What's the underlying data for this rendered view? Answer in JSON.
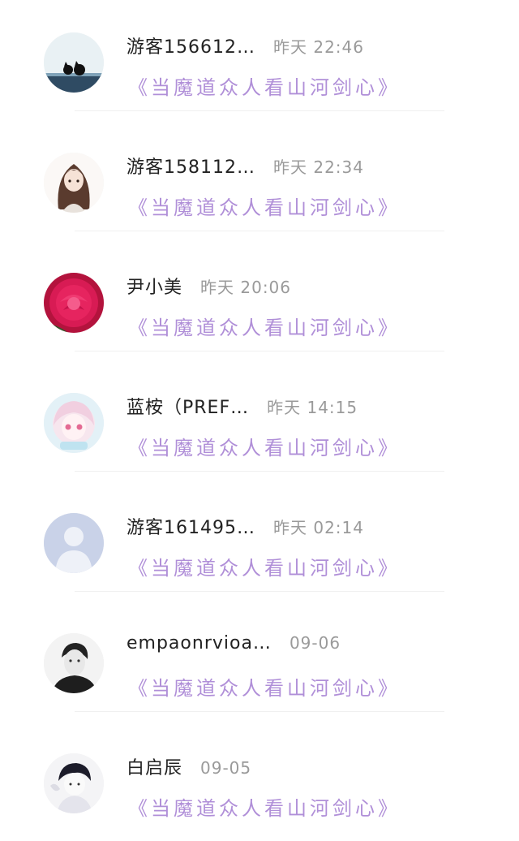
{
  "messages": [
    {
      "name": "游客156612…",
      "time": "昨天 22:46",
      "title": "《当魔道众人看山河剑心》",
      "avatar": "cats-silhouette-avatar"
    },
    {
      "name": "游客158112…",
      "time": "昨天 22:34",
      "title": "《当魔道众人看山河剑心》",
      "avatar": "girl-illustration-avatar"
    },
    {
      "name": "尹小美",
      "time": "昨天 20:06",
      "title": "《当魔道众人看山河剑心》",
      "avatar": "red-rose-avatar"
    },
    {
      "name": "蓝桉（PREF…",
      "time": "昨天 14:15",
      "title": "《当魔道众人看山河剑心》",
      "avatar": "anime-girl-avatar"
    },
    {
      "name": "游客161495…",
      "time": "昨天 02:14",
      "title": "《当魔道众人看山河剑心》",
      "avatar": "default-user-avatar"
    },
    {
      "name": "empaonrvioa…",
      "time": "09-06",
      "title": "《当魔道众人看山河剑心》",
      "avatar": "person-photo-avatar"
    },
    {
      "name": "白启辰",
      "time": "09-05",
      "title": "《当魔道众人看山河剑心》",
      "avatar": "boy-sketch-avatar"
    }
  ],
  "colors": {
    "title": "#b08fd8",
    "name": "#222222",
    "time": "#9a9a9a"
  }
}
